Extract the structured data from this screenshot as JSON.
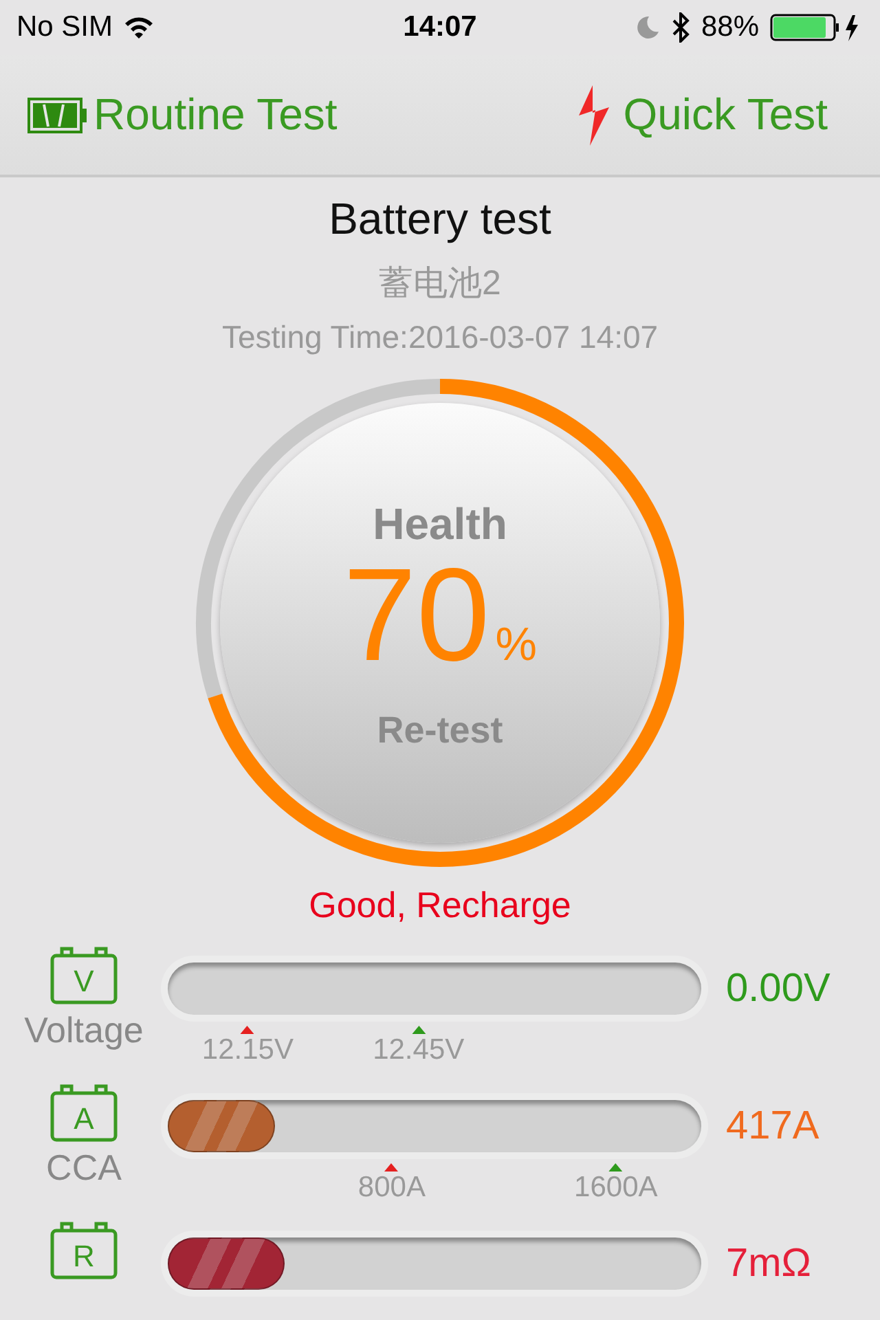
{
  "status_bar": {
    "carrier": "No SIM",
    "time": "14:07",
    "battery_percent": "88%"
  },
  "nav": [
    {
      "label": "Routine Test",
      "kind": "battery"
    },
    {
      "label": "Quick Test",
      "kind": "bolt"
    }
  ],
  "title": "Battery test",
  "battery_name": "蓄电池2",
  "testing_time": "Testing Time:2016-03-07 14:07",
  "gauge": {
    "label": "Health",
    "value": "70",
    "unit": "%",
    "button": "Re-test"
  },
  "verdict": "Good, Recharge",
  "meters": [
    {
      "letter": "V",
      "name": "Voltage",
      "value": "0.00V",
      "color": "#2e9a1c",
      "ticks": [
        {
          "label": "12.15V",
          "color": "#e52020"
        },
        {
          "label": "12.45V",
          "color": "#2e9a1c"
        }
      ]
    },
    {
      "letter": "A",
      "name": "CCA",
      "value": "417A",
      "color": "#f06a1e",
      "level": 0.2,
      "ticks": [
        {
          "label": "800A",
          "color": "#e52020"
        },
        {
          "label": "1600A",
          "color": "#2e9a1c"
        }
      ]
    },
    {
      "letter": "R",
      "value": "7mΩ",
      "color": "#e5203a",
      "level": 0.22
    }
  ]
}
